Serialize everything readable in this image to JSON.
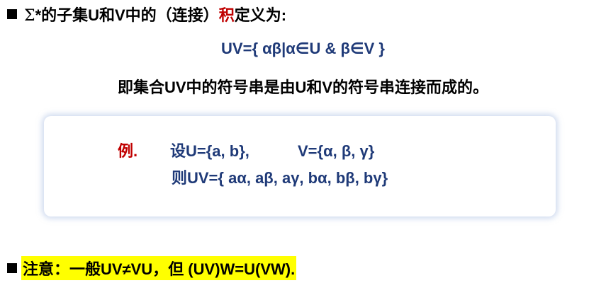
{
  "heading": {
    "sigma": "Σ",
    "text_before": "*的子集U和V中的（连接）",
    "highlight": "积",
    "text_after": "定义为:"
  },
  "formula": {
    "text": "UV={ αβ|α∈U & β∈V }"
  },
  "explanation": {
    "text": "即集合UV中的符号串是由U和V的符号串连接而成的。"
  },
  "example": {
    "label": "例.",
    "u_def": "设U={a, b},",
    "v_def": "V={α, β, γ}",
    "result": "则UV={ aα, aβ, aγ, bα, bβ, bγ}"
  },
  "note": {
    "text": "注意：一般UV≠VU，但 (UV)W=U(VW)."
  },
  "colors": {
    "title_text": "#000000",
    "formula_text": "#1f3a78",
    "accent_red": "#c00000",
    "highlight_bg": "#ffff00"
  }
}
